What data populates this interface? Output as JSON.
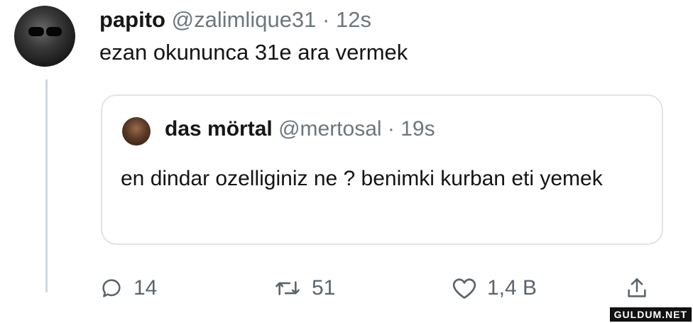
{
  "tweet": {
    "display_name": "papito",
    "handle": "@zalimlique31",
    "separator": "·",
    "time": "12s",
    "text": "ezan okununca 31e ara vermek"
  },
  "quote": {
    "display_name": "das mörtal",
    "handle": "@mertosal",
    "separator": "·",
    "time": "19s",
    "text": "en dindar ozelliginiz ne ? benimki kurban eti yemek"
  },
  "actions": {
    "reply_count": "14",
    "retweet_count": "51",
    "like_count": "1,4 B"
  },
  "icons": {
    "reply": "reply-bubble-icon",
    "retweet": "retweet-arrows-icon",
    "like": "heart-icon",
    "share": "share-upload-icon"
  },
  "watermark": "GULDUM.NET"
}
